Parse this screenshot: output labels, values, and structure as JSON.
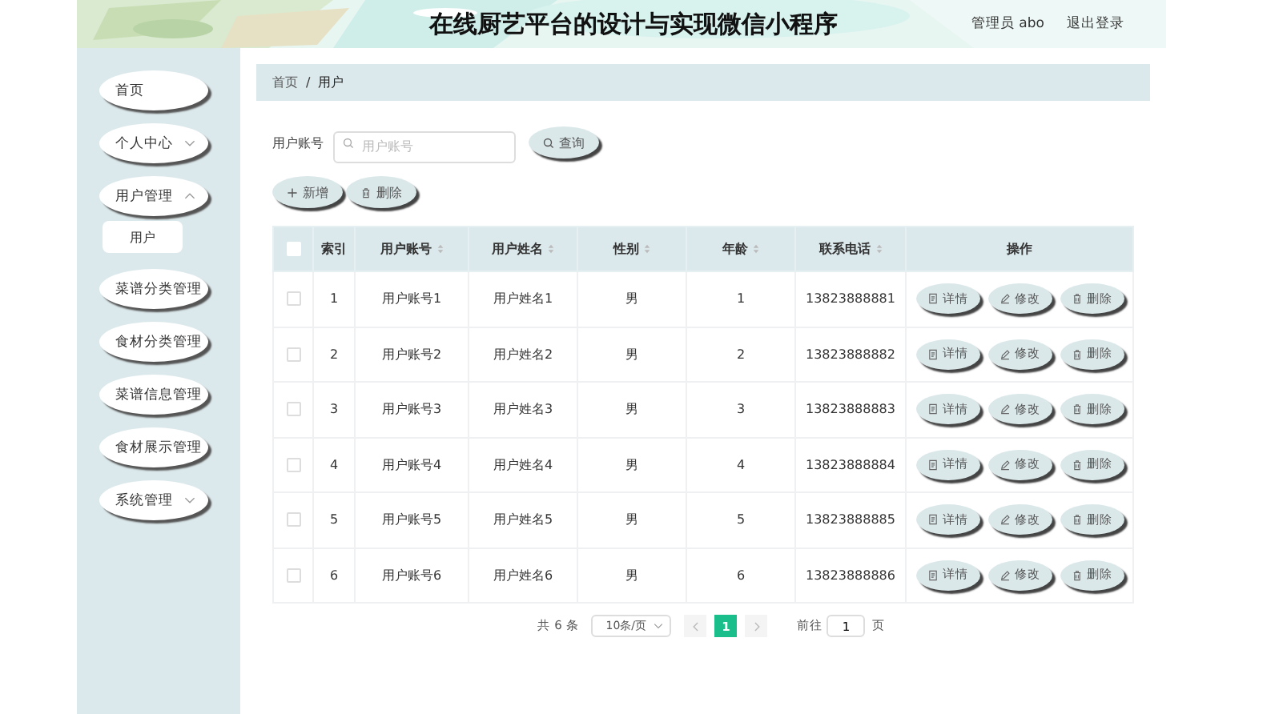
{
  "header": {
    "title": "在线厨艺平台的设计与实现微信小程序",
    "user": "管理员 abo",
    "logout": "退出登录"
  },
  "sidebar": {
    "items": [
      {
        "label": "首页",
        "kind": "link",
        "selected": false
      },
      {
        "label": "个人中心",
        "kind": "group",
        "expanded": false,
        "selected": false
      },
      {
        "label": "用户管理",
        "kind": "group",
        "expanded": true,
        "selected": false,
        "children": [
          {
            "label": "用户",
            "selected": true
          }
        ]
      },
      {
        "label": "菜谱分类管理",
        "kind": "link",
        "selected": false
      },
      {
        "label": "食材分类管理",
        "kind": "link",
        "selected": false
      },
      {
        "label": "菜谱信息管理",
        "kind": "link",
        "selected": false
      },
      {
        "label": "食材展示管理",
        "kind": "link",
        "selected": false
      },
      {
        "label": "系统管理",
        "kind": "group",
        "expanded": false,
        "selected": false
      }
    ]
  },
  "breadcrumb": {
    "items": [
      "首页",
      "用户"
    ],
    "separator": "/"
  },
  "search": {
    "label": "用户账号",
    "placeholder": "用户账号",
    "button": "查询"
  },
  "actions": [
    {
      "label": "新增",
      "kind": "add"
    },
    {
      "label": "删除",
      "kind": "delete"
    }
  ],
  "table": {
    "columns": [
      {
        "label": "索引",
        "sortable": false
      },
      {
        "label": "用户账号",
        "sortable": true
      },
      {
        "label": "用户姓名",
        "sortable": true
      },
      {
        "label": "性别",
        "sortable": true
      },
      {
        "label": "年龄",
        "sortable": true
      },
      {
        "label": "联系电话",
        "sortable": true
      },
      {
        "label": "操作",
        "sortable": false
      }
    ],
    "header_checked": false,
    "rows": [
      {
        "checked": false,
        "cells": [
          "1",
          "用户账号1",
          "用户姓名1",
          "男",
          "1",
          "13823888881"
        ],
        "actions": [
          {
            "label": "详情",
            "kind": "detail"
          },
          {
            "label": "修改",
            "kind": "edit"
          },
          {
            "label": "删除",
            "kind": "delete"
          }
        ]
      },
      {
        "checked": false,
        "cells": [
          "2",
          "用户账号2",
          "用户姓名2",
          "男",
          "2",
          "13823888882"
        ],
        "actions": [
          {
            "label": "详情",
            "kind": "detail"
          },
          {
            "label": "修改",
            "kind": "edit"
          },
          {
            "label": "删除",
            "kind": "delete"
          }
        ]
      },
      {
        "checked": false,
        "cells": [
          "3",
          "用户账号3",
          "用户姓名3",
          "男",
          "3",
          "13823888883"
        ],
        "actions": [
          {
            "label": "详情",
            "kind": "detail"
          },
          {
            "label": "修改",
            "kind": "edit"
          },
          {
            "label": "删除",
            "kind": "delete"
          }
        ]
      },
      {
        "checked": false,
        "cells": [
          "4",
          "用户账号4",
          "用户姓名4",
          "男",
          "4",
          "13823888884"
        ],
        "actions": [
          {
            "label": "详情",
            "kind": "detail"
          },
          {
            "label": "修改",
            "kind": "edit"
          },
          {
            "label": "删除",
            "kind": "delete"
          }
        ]
      },
      {
        "checked": false,
        "cells": [
          "5",
          "用户账号5",
          "用户姓名5",
          "男",
          "5",
          "13823888885"
        ],
        "actions": [
          {
            "label": "详情",
            "kind": "detail"
          },
          {
            "label": "修改",
            "kind": "edit"
          },
          {
            "label": "删除",
            "kind": "delete"
          }
        ]
      },
      {
        "checked": false,
        "cells": [
          "6",
          "用户账号6",
          "用户姓名6",
          "男",
          "6",
          "13823888886"
        ],
        "actions": [
          {
            "label": "详情",
            "kind": "detail"
          },
          {
            "label": "修改",
            "kind": "edit"
          },
          {
            "label": "删除",
            "kind": "delete"
          }
        ]
      }
    ]
  },
  "pagination": {
    "total": "共 6 条",
    "page_size": "10条/页",
    "pages": [
      {
        "label": "1",
        "selected": true
      }
    ],
    "goto": "前往",
    "goto_value": "1",
    "page_unit": "页"
  }
}
